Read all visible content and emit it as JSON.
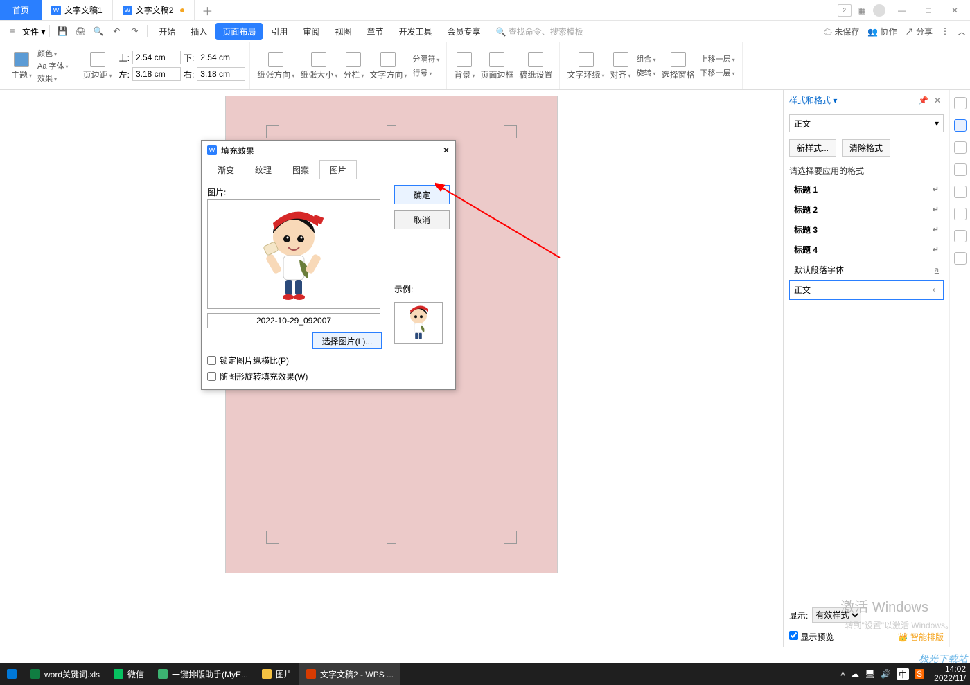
{
  "titlebar": {
    "home": "首页",
    "doc1": "文字文稿1",
    "doc2": "文字文稿2",
    "badge": "2"
  },
  "menurow": {
    "file": "文件",
    "tabs": [
      "开始",
      "插入",
      "页面布局",
      "引用",
      "审阅",
      "视图",
      "章节",
      "开发工具",
      "会员专享"
    ],
    "search_placeholder": "查找命令、搜索模板",
    "unsaved": "未保存",
    "coop": "协作",
    "share": "分享"
  },
  "ribbon": {
    "theme": "主题",
    "color": "颜色",
    "font": "Aa 字体",
    "effect": "效果",
    "margins": "页边距",
    "top_label": "上:",
    "bottom_label": "下:",
    "left_label": "左:",
    "right_label": "右:",
    "top_val": "2.54 cm",
    "bottom_val": "2.54 cm",
    "left_val": "3.18 cm",
    "right_val": "3.18 cm",
    "paper_dir": "纸张方向",
    "paper_size": "纸张大小",
    "columns": "分栏",
    "text_dir": "文字方向",
    "breaks": "分隔符",
    "line_no": "行号",
    "background": "背景",
    "page_border": "页面边框",
    "manuscript": "稿纸设置",
    "wrap": "文字环绕",
    "align": "对齐",
    "rotate": "旋转",
    "group": "组合",
    "select_pane": "选择窗格",
    "bring_fwd": "上移一层",
    "send_back": "下移一层"
  },
  "dialog": {
    "title": "填充效果",
    "tabs": [
      "渐变",
      "纹理",
      "图案",
      "图片"
    ],
    "pic_label": "图片:",
    "file_name": "2022-10-29_092007",
    "select_pic": "选择图片(L)...",
    "sample_label": "示例:",
    "lock_ratio": "锁定图片纵横比(P)",
    "rotate_fill": "随图形旋转填充效果(W)",
    "ok": "确定",
    "cancel": "取消"
  },
  "panel": {
    "title": "样式和格式",
    "current": "正文",
    "new_style": "新样式...",
    "clear": "清除格式",
    "hint": "请选择要应用的格式",
    "styles": [
      "标题 1",
      "标题 2",
      "标题 3",
      "标题 4"
    ],
    "default_font": "默认段落字体",
    "body": "正文",
    "show_label": "显示:",
    "show_value": "有效样式",
    "preview": "显示预览",
    "smart_layout": "智能排版"
  },
  "watermark": {
    "line1": "激活 Windows",
    "line2": "转到\"设置\"以激活 Windows。"
  },
  "brand_watermark": "极光下载站",
  "taskbar": {
    "items": [
      "word关键词.xls",
      "微信",
      "一键排版助手(MyE...",
      "图片",
      "文字文稿2 - WPS ..."
    ],
    "ime": "中",
    "time": "14:02",
    "date": "2022/11/"
  }
}
